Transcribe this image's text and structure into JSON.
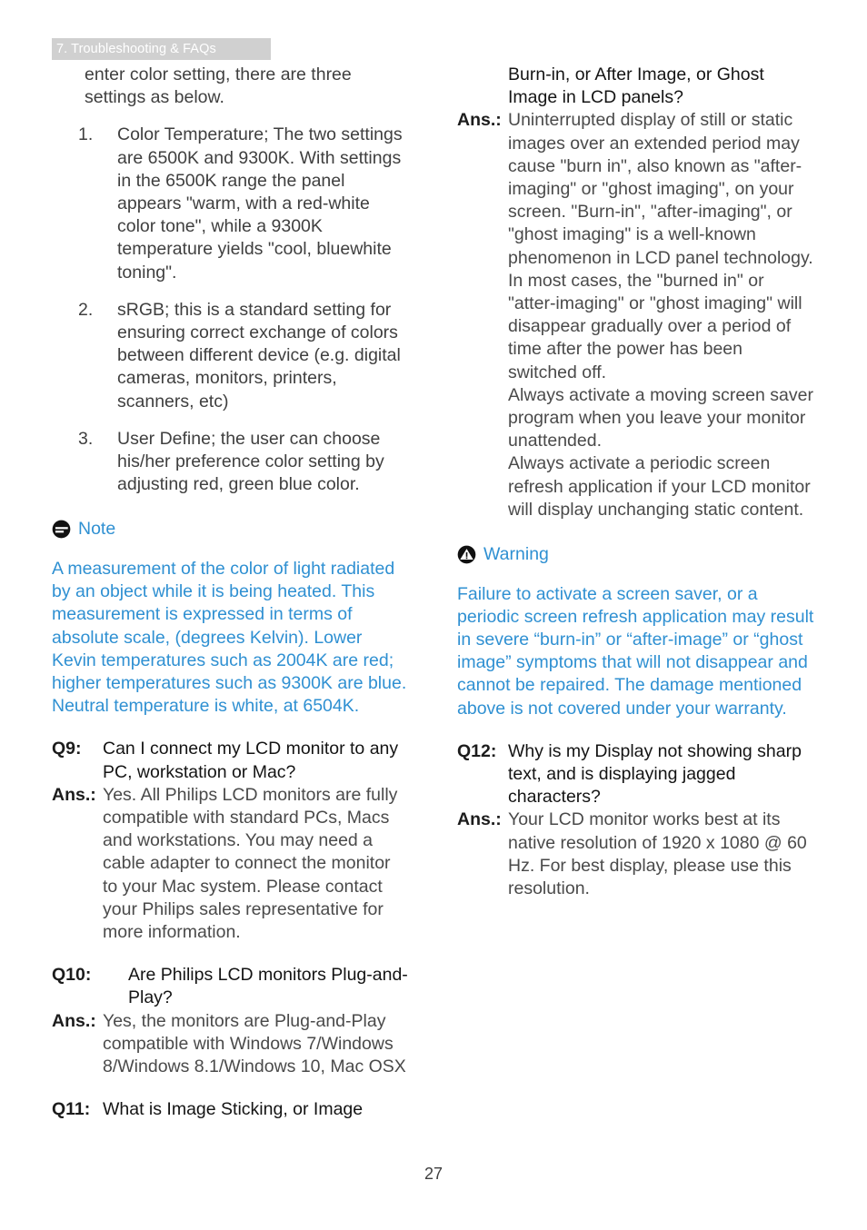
{
  "running_head": "7. Troubleshooting & FAQs",
  "page_number": "27",
  "colors": {
    "accent_blue": "#2f90d2",
    "running_head_band": "#d0d0d0",
    "body_text": "#3f3f3f"
  },
  "left_column": {
    "intro_paragraph": "enter color setting, there are three settings as below.",
    "numbered_items": [
      {
        "number": "1.",
        "text": "Color Temperature; The two settings are 6500K and 9300K. With settings in the 6500K range the panel appears \"warm, with a red-white color tone\", while a 9300K temperature yields \"cool, bluewhite toning\"."
      },
      {
        "number": "2.",
        "text": "sRGB; this is a standard setting for ensuring correct exchange of colors between different device (e.g. digital cameras, monitors, printers, scanners, etc)"
      },
      {
        "number": "3.",
        "text": "User Define; the user can choose his/her preference color setting by adjusting red, green blue color."
      }
    ],
    "note": {
      "icon": "note-icon",
      "title": "Note",
      "body": "A measurement of the color of light radiated by an object while it is being heated. This measurement is expressed in terms of absolute scale, (degrees Kelvin). Lower Kevin temperatures such as 2004K are red; higher temperatures such as 9300K are blue. Neutral temperature is white, at 6504K."
    },
    "qa": [
      {
        "q_label": "Q9:",
        "q_text": "Can I connect my LCD monitor to any PC, workstation or Mac?",
        "a_label": "Ans.:",
        "a_text": "Yes. All Philips LCD monitors are fully compatible with standard PCs, Macs and workstations. You may need a cable adapter to connect the monitor to your Mac system. Please contact your Philips sales representative for more information."
      },
      {
        "q_label": "Q10:",
        "q_text": "Are Philips LCD monitors Plug-and- Play?",
        "a_label": "Ans.:",
        "a_text": "Yes, the monitors are Plug-and-Play compatible with Windows 7/Windows 8/Windows 8.1/Windows 10, Mac OSX"
      },
      {
        "q_label": "Q11:",
        "q_text": "What is Image Sticking, or Image"
      }
    ]
  },
  "right_column": {
    "q11_continued": {
      "q_text": "Burn-in, or After Image, or Ghost Image in LCD panels?",
      "a_label": "Ans.:",
      "a_text": "Uninterrupted display of still or static images over an extended period may cause \"burn in\", also known as \"after-imaging\" or \"ghost imaging\", on your screen. \"Burn-in\", \"after-imaging\", or \"ghost imaging\" is a well-known phenomenon in LCD panel technology. In most cases, the \"burned in\" or \"atter-imaging\" or \"ghost imaging\" will disappear gradually over a period of time after the power has been switched off.",
      "a_text_2": "Always activate a moving screen saver program when you leave your monitor unattended.",
      "a_text_3": "Always activate a periodic screen refresh application if your LCD monitor will display unchanging static content."
    },
    "warning": {
      "icon": "warning-icon",
      "title": "Warning",
      "body": "Failure to activate a screen saver, or a periodic screen refresh application may result in severe “burn-in” or “after-image” or “ghost image” symptoms that will not disappear and cannot be repaired. The damage mentioned above is not covered under your warranty."
    },
    "qa": [
      {
        "q_label": "Q12:",
        "q_text": "Why is my Display not showing sharp text, and is displaying jagged characters?",
        "a_label": "Ans.:",
        "a_text": "Your LCD monitor works best at its native resolution of 1920 x 1080 @ 60 Hz. For best display, please use this resolution."
      }
    ]
  }
}
